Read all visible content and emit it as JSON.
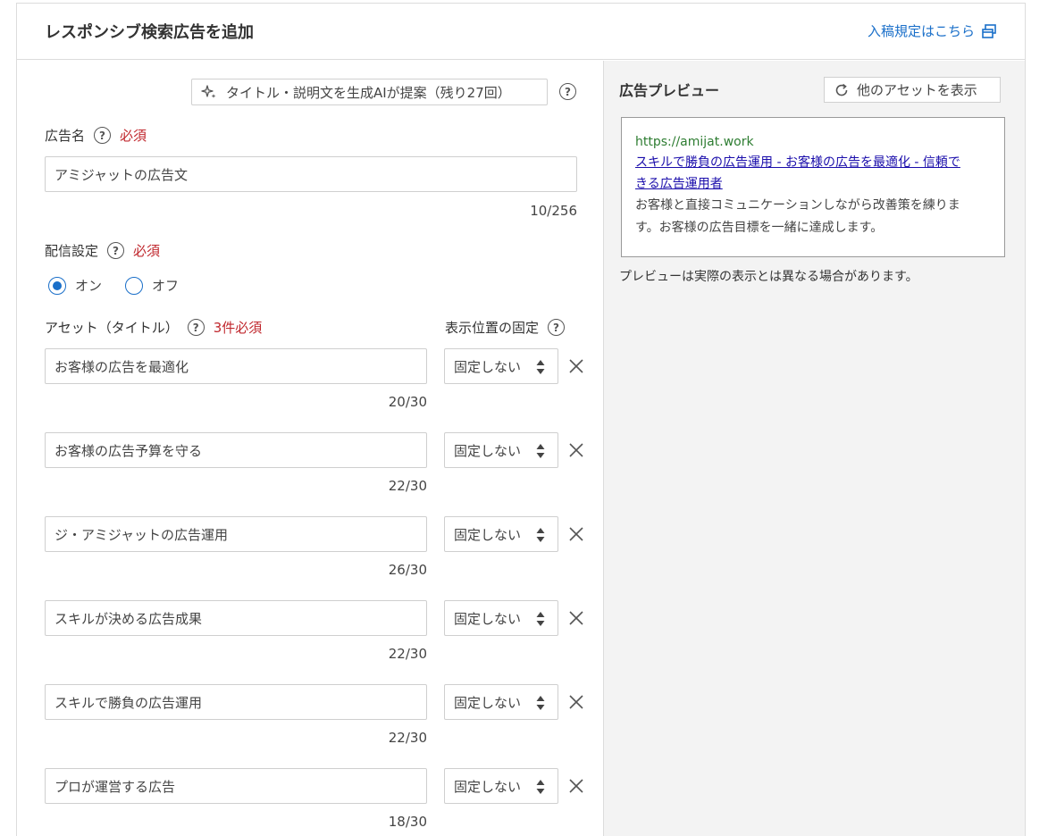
{
  "header": {
    "title": "レスポンシブ検索広告を追加",
    "link_label": "入稿規定はこちら",
    "link_icon": "external-window-icon"
  },
  "ai_suggest": {
    "label": "タイトル・説明文を生成AIが提案（残り27回）",
    "icon": "sparkle-icon"
  },
  "ad_name": {
    "label": "広告名",
    "required": "必須",
    "value": "アミジャットの広告文",
    "count": "10/256"
  },
  "delivery": {
    "label": "配信設定",
    "required": "必須",
    "options": [
      "オン",
      "オフ"
    ],
    "selected": "オン"
  },
  "assets": {
    "label": "アセット（タイトル）",
    "required": "3件必須",
    "pin_label": "表示位置の固定",
    "items": [
      {
        "value": "お客様の広告を最適化",
        "count": "20/30",
        "pin": "固定しない"
      },
      {
        "value": "お客様の広告予算を守る",
        "count": "22/30",
        "pin": "固定しない"
      },
      {
        "value": "ジ・アミジャットの広告運用",
        "count": "26/30",
        "pin": "固定しない"
      },
      {
        "value": "スキルが決める広告成果",
        "count": "22/30",
        "pin": "固定しない"
      },
      {
        "value": "スキルで勝負の広告運用",
        "count": "22/30",
        "pin": "固定しない"
      },
      {
        "value": "プロが運営する広告",
        "count": "18/30",
        "pin": "固定しない"
      }
    ]
  },
  "preview": {
    "title": "広告プレビュー",
    "other_assets_label": "他のアセットを表示",
    "url": "https://amijat.work",
    "headline_line1": "スキルで勝負の広告運用 - お客様の広告を最適化 - 信頼で",
    "headline_line2": "きる広告運用者",
    "desc_line1": "お客様と直接コミュニケーションしながら改善策を練りま",
    "desc_line2": "す。お客様の広告目標を一緒に達成します。",
    "note": "プレビューは実際の表示とは異なる場合があります。"
  },
  "colors": {
    "accent": "#1a6fc9",
    "required": "#c0272d",
    "url_green": "#2e7d32",
    "headline_link": "#1a0dab"
  }
}
